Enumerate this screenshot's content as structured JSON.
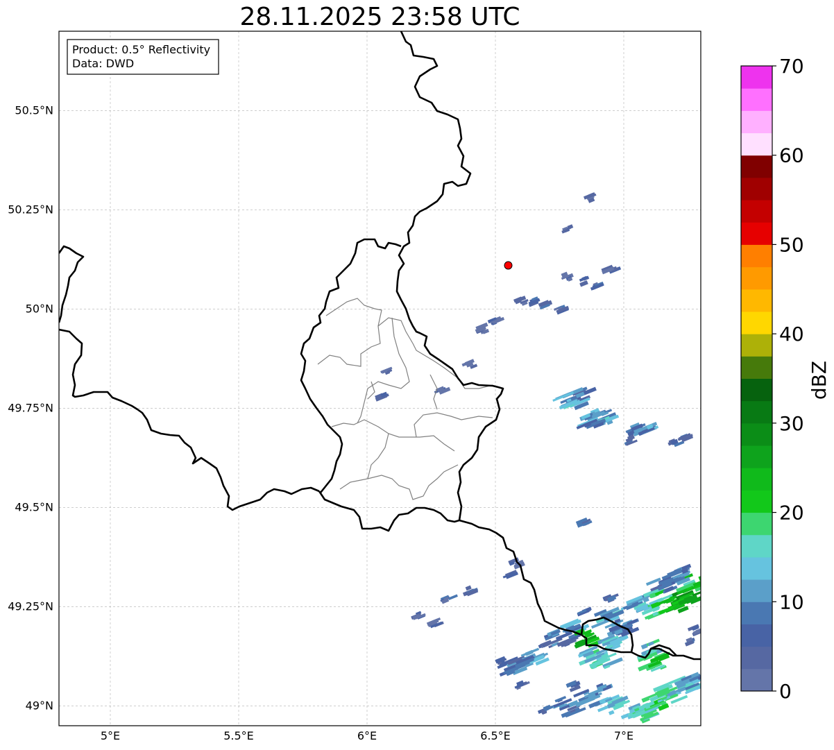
{
  "title": "28.11.2025 23:58 UTC",
  "info_box": {
    "product_line": "Product: 0.5° Reflectivity",
    "data_line": "Data: DWD"
  },
  "map": {
    "extent_lon": [
      4.8,
      7.3
    ],
    "extent_lat": [
      48.95,
      50.7
    ],
    "lat_ticks": [
      {
        "value": 49.0,
        "label": "49°N"
      },
      {
        "value": 49.25,
        "label": "49.25°N"
      },
      {
        "value": 49.5,
        "label": "49.5°N"
      },
      {
        "value": 49.75,
        "label": "49.75°N"
      },
      {
        "value": 50.0,
        "label": "50°N"
      },
      {
        "value": 50.25,
        "label": "50.25°N"
      },
      {
        "value": 50.5,
        "label": "50.5°N"
      }
    ],
    "lon_ticks": [
      {
        "value": 5.0,
        "label": "5°E"
      },
      {
        "value": 5.5,
        "label": "5.5°E"
      },
      {
        "value": 6.0,
        "label": "6°E"
      },
      {
        "value": 6.5,
        "label": "6.5°E"
      },
      {
        "value": 7.0,
        "label": "7°E"
      }
    ],
    "radar_site": {
      "lon": 6.55,
      "lat": 50.11,
      "color": "#ff0000"
    },
    "colors": {
      "border": "#000000",
      "admin_border": "#808080",
      "grid": "#b0b0b0"
    }
  },
  "colorbar": {
    "label": "dBZ",
    "ticks": [
      {
        "value": 0,
        "label": "0"
      },
      {
        "value": 10,
        "label": "10"
      },
      {
        "value": 20,
        "label": "20"
      },
      {
        "value": 30,
        "label": "30"
      },
      {
        "value": 40,
        "label": "40"
      },
      {
        "value": 50,
        "label": "50"
      },
      {
        "value": 60,
        "label": "60"
      },
      {
        "value": 70,
        "label": "70"
      }
    ],
    "range": [
      0,
      70
    ],
    "step": 2.5,
    "colors": [
      "#6475a9",
      "#5668a2",
      "#4863a5",
      "#4a78b2",
      "#5b9fc9",
      "#66c3df",
      "#5fd6c7",
      "#3dd670",
      "#12c81a",
      "#10ba1b",
      "#0ea31c",
      "#0b8d17",
      "#087a14",
      "#06620e",
      "#467a0b",
      "#adb108",
      "#ffd700",
      "#ffb800",
      "#ff9a00",
      "#ff7f00",
      "#e60000",
      "#c40000",
      "#a00000",
      "#800000",
      "#ffe0ff",
      "#ffb0ff",
      "#ff70ff",
      "#ee33ee"
    ]
  },
  "echoes": [
    {
      "lon": 6.6,
      "lat": 50.02,
      "dbz": 5
    },
    {
      "lon": 6.66,
      "lat": 50.02,
      "dbz": 7
    },
    {
      "lon": 6.7,
      "lat": 50.01,
      "dbz": 5
    },
    {
      "lon": 6.75,
      "lat": 50.0,
      "dbz": 4
    },
    {
      "lon": 6.78,
      "lat": 50.08,
      "dbz": 4
    },
    {
      "lon": 6.85,
      "lat": 50.07,
      "dbz": 3
    },
    {
      "lon": 6.9,
      "lat": 50.06,
      "dbz": 4
    },
    {
      "lon": 6.95,
      "lat": 50.1,
      "dbz": 3
    },
    {
      "lon": 6.88,
      "lat": 50.28,
      "dbz": 3
    },
    {
      "lon": 6.78,
      "lat": 50.2,
      "dbz": 3
    },
    {
      "lon": 6.45,
      "lat": 49.95,
      "dbz": 3
    },
    {
      "lon": 6.5,
      "lat": 49.97,
      "dbz": 3
    },
    {
      "lon": 6.4,
      "lat": 49.86,
      "dbz": 3
    },
    {
      "lon": 6.3,
      "lat": 49.8,
      "dbz": 3
    },
    {
      "lon": 6.08,
      "lat": 49.84,
      "dbz": 3
    },
    {
      "lon": 6.06,
      "lat": 49.78,
      "dbz": 4
    },
    {
      "lon": 6.82,
      "lat": 49.78,
      "dbz": 8
    },
    {
      "lon": 6.8,
      "lat": 49.77,
      "dbz": 12
    },
    {
      "lon": 6.92,
      "lat": 49.73,
      "dbz": 12
    },
    {
      "lon": 6.89,
      "lat": 49.72,
      "dbz": 9
    },
    {
      "lon": 7.07,
      "lat": 49.7,
      "dbz": 10
    },
    {
      "lon": 7.02,
      "lat": 49.67,
      "dbz": 6
    },
    {
      "lon": 7.2,
      "lat": 49.66,
      "dbz": 6
    },
    {
      "lon": 7.24,
      "lat": 49.68,
      "dbz": 5
    },
    {
      "lon": 6.85,
      "lat": 49.46,
      "dbz": 5
    },
    {
      "lon": 6.4,
      "lat": 49.29,
      "dbz": 5
    },
    {
      "lon": 6.32,
      "lat": 49.27,
      "dbz": 5
    },
    {
      "lon": 6.55,
      "lat": 49.33,
      "dbz": 4
    },
    {
      "lon": 6.58,
      "lat": 49.36,
      "dbz": 3
    },
    {
      "lon": 6.27,
      "lat": 49.21,
      "dbz": 3
    },
    {
      "lon": 6.2,
      "lat": 49.23,
      "dbz": 3
    },
    {
      "lon": 6.58,
      "lat": 49.1,
      "dbz": 8
    },
    {
      "lon": 6.52,
      "lat": 49.11,
      "dbz": 6
    },
    {
      "lon": 6.65,
      "lat": 49.12,
      "dbz": 10
    },
    {
      "lon": 6.7,
      "lat": 49.15,
      "dbz": 5
    },
    {
      "lon": 6.75,
      "lat": 49.17,
      "dbz": 8
    },
    {
      "lon": 6.82,
      "lat": 49.19,
      "dbz": 10
    },
    {
      "lon": 6.88,
      "lat": 49.13,
      "dbz": 14
    },
    {
      "lon": 6.92,
      "lat": 49.11,
      "dbz": 16
    },
    {
      "lon": 6.86,
      "lat": 49.17,
      "dbz": 22
    },
    {
      "lon": 6.95,
      "lat": 49.15,
      "dbz": 14
    },
    {
      "lon": 6.94,
      "lat": 49.22,
      "dbz": 12
    },
    {
      "lon": 7.0,
      "lat": 49.2,
      "dbz": 9
    },
    {
      "lon": 7.05,
      "lat": 49.26,
      "dbz": 11
    },
    {
      "lon": 7.1,
      "lat": 49.24,
      "dbz": 16
    },
    {
      "lon": 7.15,
      "lat": 49.27,
      "dbz": 18
    },
    {
      "lon": 7.2,
      "lat": 49.25,
      "dbz": 24
    },
    {
      "lon": 7.25,
      "lat": 49.28,
      "dbz": 26
    },
    {
      "lon": 7.28,
      "lat": 49.31,
      "dbz": 21
    },
    {
      "lon": 7.22,
      "lat": 49.33,
      "dbz": 9
    },
    {
      "lon": 7.15,
      "lat": 49.3,
      "dbz": 8
    },
    {
      "lon": 6.95,
      "lat": 49.27,
      "dbz": 7
    },
    {
      "lon": 6.85,
      "lat": 49.24,
      "dbz": 6
    },
    {
      "lon": 7.1,
      "lat": 49.14,
      "dbz": 14
    },
    {
      "lon": 7.12,
      "lat": 49.11,
      "dbz": 20
    },
    {
      "lon": 7.25,
      "lat": 49.16,
      "dbz": 6
    },
    {
      "lon": 7.28,
      "lat": 49.19,
      "dbz": 4
    },
    {
      "lon": 6.7,
      "lat": 48.99,
      "dbz": 6
    },
    {
      "lon": 6.78,
      "lat": 49.0,
      "dbz": 8
    },
    {
      "lon": 6.87,
      "lat": 49.02,
      "dbz": 10
    },
    {
      "lon": 6.95,
      "lat": 49.0,
      "dbz": 14
    },
    {
      "lon": 7.02,
      "lat": 48.99,
      "dbz": 15
    },
    {
      "lon": 7.08,
      "lat": 48.98,
      "dbz": 16
    },
    {
      "lon": 7.12,
      "lat": 49.01,
      "dbz": 18
    },
    {
      "lon": 7.18,
      "lat": 49.03,
      "dbz": 16
    },
    {
      "lon": 7.24,
      "lat": 49.05,
      "dbz": 14
    },
    {
      "lon": 7.28,
      "lat": 49.06,
      "dbz": 11
    },
    {
      "lon": 6.8,
      "lat": 49.05,
      "dbz": 5
    },
    {
      "lon": 6.92,
      "lat": 49.05,
      "dbz": 7
    },
    {
      "lon": 6.6,
      "lat": 49.05,
      "dbz": 5
    }
  ]
}
